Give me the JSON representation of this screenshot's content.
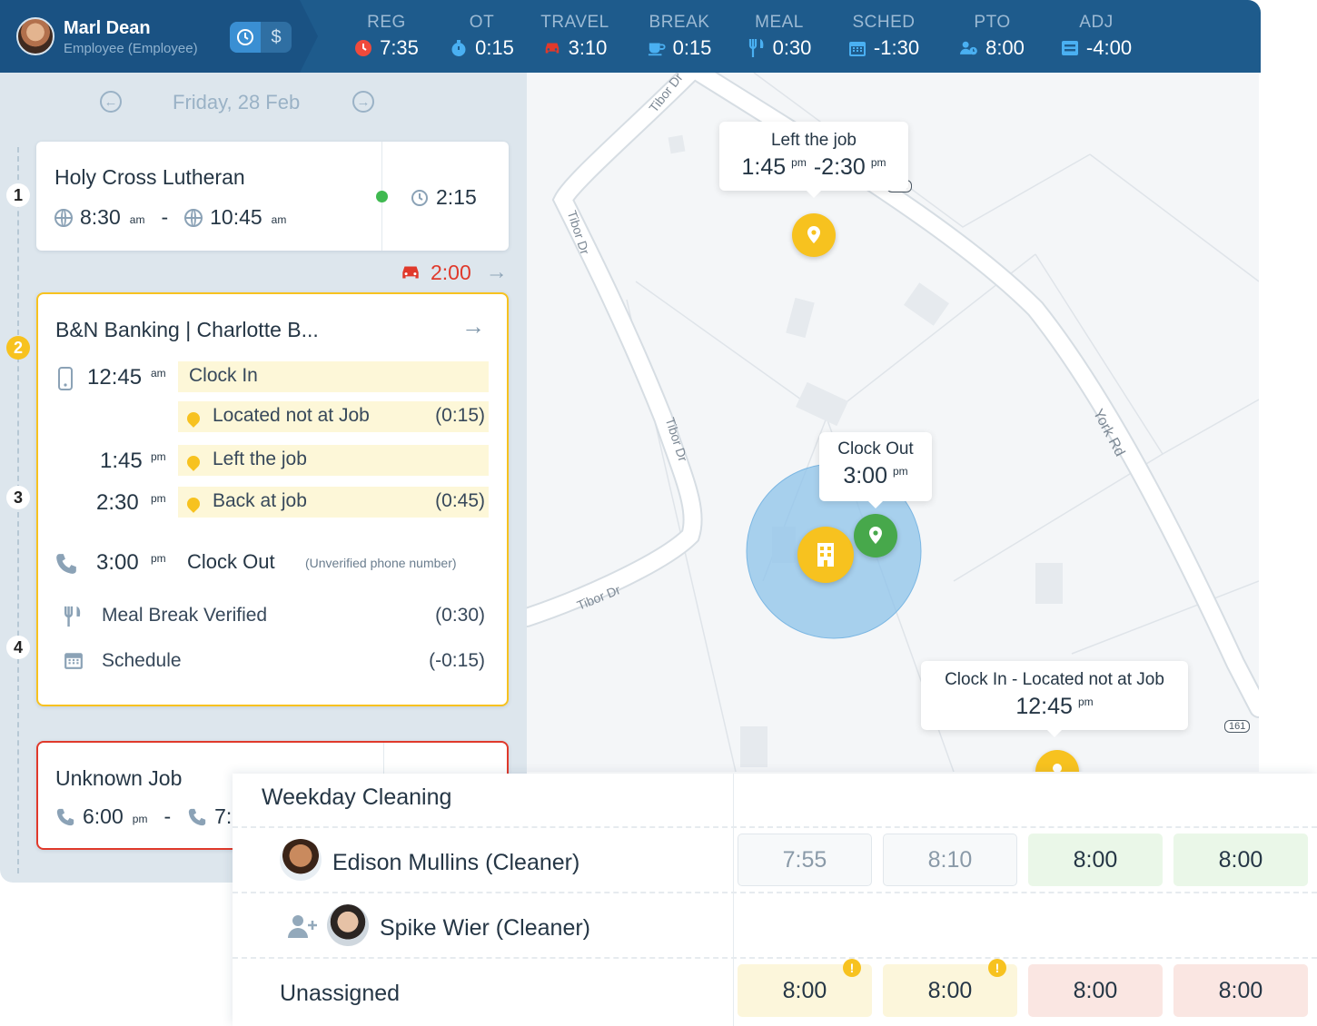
{
  "header": {
    "employee_name": "Marl Dean",
    "employee_role": "Employee (Employee)",
    "mode_icons": [
      "clock-icon",
      "dollar-icon"
    ],
    "dollar_glyph": "$",
    "stats": [
      {
        "label": "REG",
        "value": "7:35",
        "icon": "clock-icon",
        "color": "#f04a3c"
      },
      {
        "label": "OT",
        "value": "0:15",
        "icon": "stopwatch-icon",
        "color": "#4ab0f2"
      },
      {
        "label": "TRAVEL",
        "value": "3:10",
        "icon": "car-icon",
        "color": "#e0392b"
      },
      {
        "label": "BREAK",
        "value": "0:15",
        "icon": "coffee-icon",
        "color": "#4ab0f2"
      },
      {
        "label": "MEAL",
        "value": "0:30",
        "icon": "utensils-icon",
        "color": "#4ab0f2"
      },
      {
        "label": "SCHED",
        "value": "-1:30",
        "icon": "calendar-icon",
        "color": "#4ab0f2"
      },
      {
        "label": "PTO",
        "value": "8:00",
        "icon": "user-clock-icon",
        "color": "#4ab0f2"
      },
      {
        "label": "ADJ",
        "value": "-4:00",
        "icon": "adjust-icon",
        "color": "#4ab0f2"
      }
    ]
  },
  "date_nav": {
    "label": "Friday, 28 Feb"
  },
  "steps": [
    "1",
    "2",
    "3",
    "4"
  ],
  "job1": {
    "title": "Holy Cross Lutheran",
    "start": "8:30",
    "start_ap": "am",
    "end": "10:45",
    "end_ap": "am",
    "sep": "-",
    "duration": "2:15",
    "status_color": "#3fb950"
  },
  "travel": {
    "value": "2:00",
    "color": "#e0392b"
  },
  "job2": {
    "title": "B&N Banking | Charlotte B...",
    "events": [
      {
        "time": "12:45",
        "ap": "am",
        "label": "Clock In",
        "amount": "",
        "icon": "mobile-icon"
      },
      {
        "time": "",
        "ap": "",
        "label": "Located not at Job",
        "amount": "(0:15)",
        "icon": "map-pin-icon"
      },
      {
        "time": "1:45",
        "ap": "pm",
        "label": "Left the job",
        "amount": "",
        "icon": "map-pin-icon"
      },
      {
        "time": "2:30",
        "ap": "pm",
        "label": "Back at job",
        "amount": "(0:45)",
        "icon": "map-pin-icon"
      },
      {
        "time": "3:00",
        "ap": "pm",
        "label": "Clock Out",
        "note": "(Unverified phone number)",
        "icon": "phone-icon"
      },
      {
        "label": "Meal Break Verified",
        "amount": "(0:30)",
        "icon": "utensils-icon"
      },
      {
        "label": "Schedule",
        "amount": "(-0:15)",
        "icon": "calendar-icon"
      }
    ]
  },
  "job3": {
    "title": "Unknown Job",
    "start": "6:00",
    "start_ap": "pm",
    "end_partial": "7:",
    "sep": "-"
  },
  "map": {
    "streets": [
      "Tibor Dr",
      "Tibor Dr",
      "Tibor Dr",
      "Tibor Dr",
      "York Rd"
    ],
    "route_badges": [
      "161",
      "161"
    ],
    "callouts": {
      "left_job": {
        "title": "Left the job",
        "t1": "1:45",
        "ap1": "pm",
        "t2": "-2:30",
        "ap2": "pm"
      },
      "clock_out": {
        "title": "Clock Out",
        "time": "3:00",
        "ap": "pm"
      },
      "clock_in": {
        "title": "Clock In - Located not at Job",
        "time": "12:45",
        "ap": "pm"
      }
    },
    "geofence_color": "#8ec3ea",
    "marker_color": "#f7c21f",
    "pin_color": "#47a84b"
  },
  "schedule": {
    "title": "Weekday Cleaning",
    "rows": [
      {
        "name": "Edison Mullins (Cleaner)",
        "cells": [
          {
            "value": "7:55",
            "style": "light"
          },
          {
            "value": "8:10",
            "style": "light"
          },
          {
            "value": "8:00",
            "style": "green"
          },
          {
            "value": "8:00",
            "style": "green"
          }
        ]
      },
      {
        "name": "Spike Wier (Cleaner)",
        "cells": []
      },
      {
        "name": "Unassigned",
        "cells": [
          {
            "value": "8:00",
            "style": "yellow",
            "warn": "!"
          },
          {
            "value": "8:00",
            "style": "yellow",
            "warn": "!"
          },
          {
            "value": "8:00",
            "style": "red"
          },
          {
            "value": "8:00",
            "style": "red"
          }
        ]
      }
    ]
  }
}
